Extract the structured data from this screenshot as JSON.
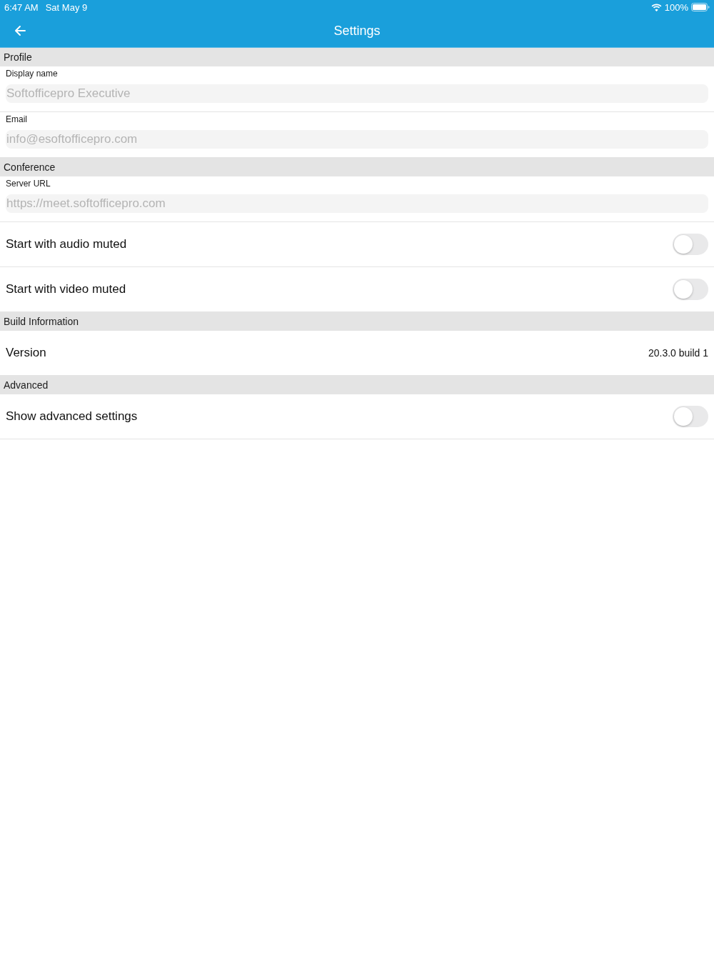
{
  "status_bar": {
    "time": "6:47 AM",
    "date": "Sat May 9",
    "battery": "100%"
  },
  "header": {
    "title": "Settings"
  },
  "sections": [
    {
      "title": "Profile",
      "rows": [
        {
          "kind": "field",
          "label": "Display name",
          "placeholder": "Softofficepro Executive"
        },
        {
          "kind": "field",
          "label": "Email",
          "placeholder": "info@esoftofficepro.com"
        }
      ]
    },
    {
      "title": "Conference",
      "rows": [
        {
          "kind": "field",
          "label": "Server URL",
          "placeholder": "https://meet.softofficepro.com"
        },
        {
          "kind": "toggle",
          "label": "Start with audio muted",
          "on": false
        },
        {
          "kind": "toggle",
          "label": "Start with video muted",
          "on": false
        }
      ]
    },
    {
      "title": "Build Information",
      "rows": [
        {
          "kind": "info",
          "label": "Version",
          "value": "20.3.0 build 1"
        }
      ]
    },
    {
      "title": "Advanced",
      "rows": [
        {
          "kind": "toggle",
          "label": "Show advanced settings",
          "on": false
        }
      ]
    }
  ]
}
